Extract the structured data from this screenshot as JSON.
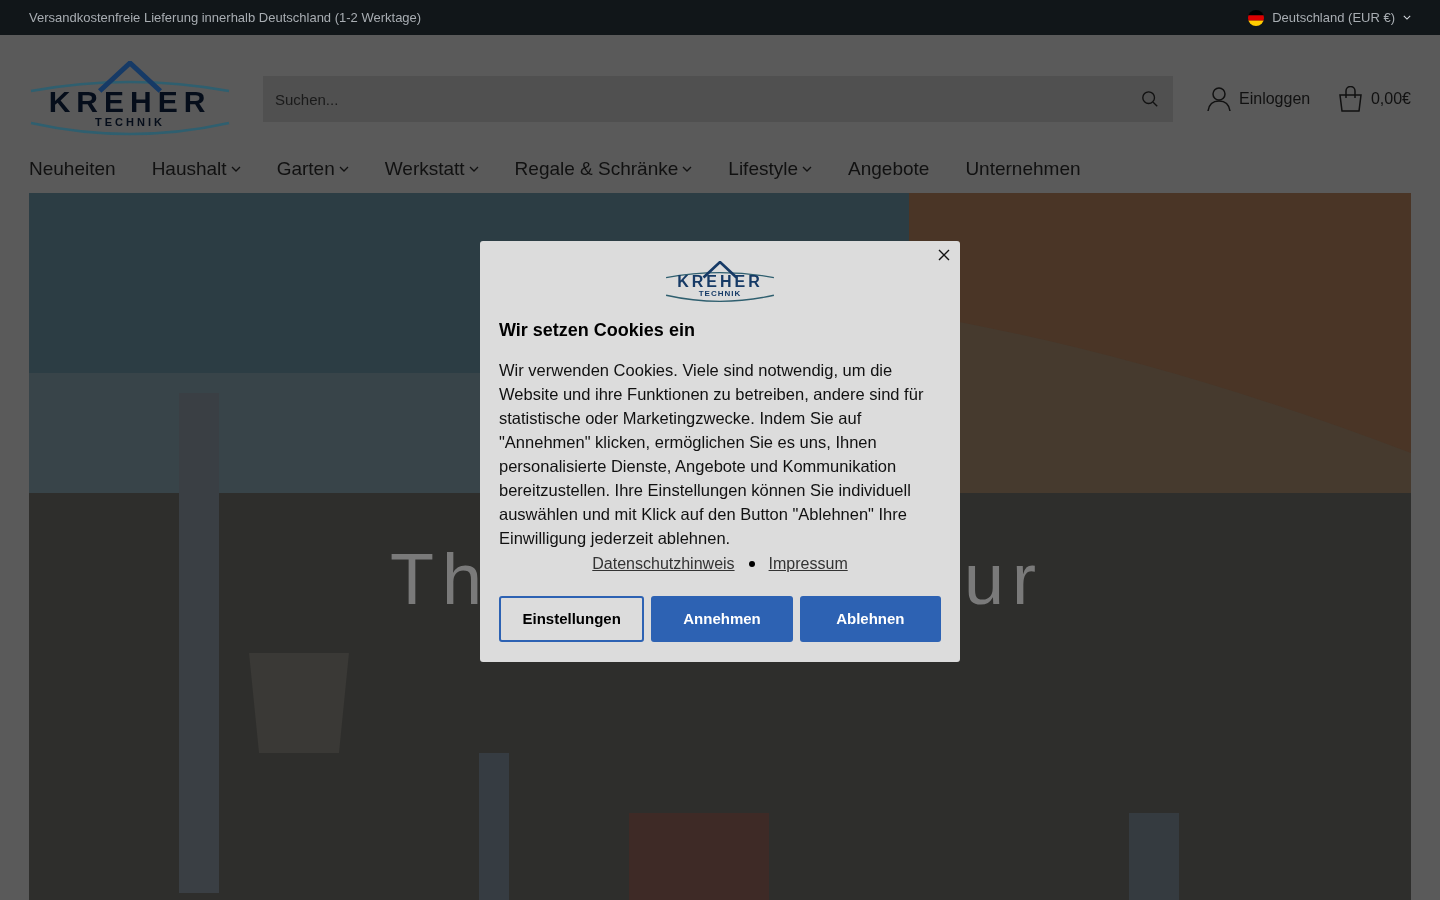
{
  "top_bar": {
    "notice": "Versandkostenfreie Lieferung innerhalb Deutschland (1-2 Werktage)",
    "country": "Deutschland (EUR €)"
  },
  "header": {
    "logo": {
      "name": "KREHER",
      "sub": "TECHNIK"
    },
    "search": {
      "placeholder": "Suchen..."
    },
    "login": "Einloggen",
    "cart": "0,00€"
  },
  "nav": [
    {
      "label": "Neuheiten",
      "dropdown": false
    },
    {
      "label": "Haushalt",
      "dropdown": true
    },
    {
      "label": "Garten",
      "dropdown": true
    },
    {
      "label": "Werkstatt",
      "dropdown": true
    },
    {
      "label": "Regale & Schränke",
      "dropdown": true
    },
    {
      "label": "Lifestyle",
      "dropdown": true
    },
    {
      "label": "Angebote",
      "dropdown": false
    },
    {
      "label": "Unternehmen",
      "dropdown": false
    }
  ],
  "hero": {
    "kind": "picture",
    "heading_left": "Th",
    "heading_right": "ur"
  },
  "cookie_dialog": {
    "logo": {
      "name": "KREHER",
      "sub": "TECHNIK"
    },
    "title": "Wir setzen Cookies ein",
    "body": "Wir verwenden Cookies. Viele sind notwendig, um die Website und ihre Funktionen zu betreiben, andere sind für statistische oder Marketingzwecke. Indem Sie auf \"Annehmen\" klicken, ermöglichen Sie es uns, Ihnen personalisierte Dienste, Angebote und Kommunikation bereitzustellen. Ihre Einstellungen können Sie individuell auswählen und mit Klick auf den Button \"Ablehnen\" Ihre Einwilligung jederzeit ablehnen.",
    "links": [
      "Datenschutzhinweis",
      "Impressum"
    ],
    "buttons": [
      {
        "label": "Einstellungen",
        "kind": "outline"
      },
      {
        "label": "Annehmen",
        "kind": "filled"
      },
      {
        "label": "Ablehnen",
        "kind": "filled"
      }
    ]
  }
}
